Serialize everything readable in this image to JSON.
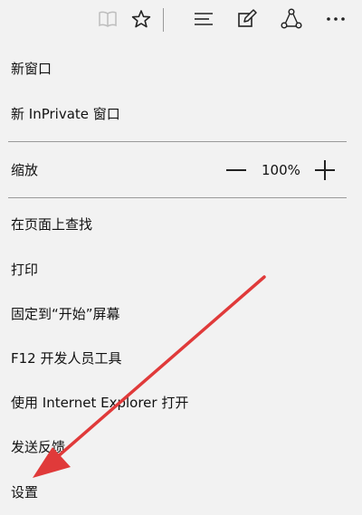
{
  "toolbar": {
    "icons": [
      "reading-view-icon",
      "favorite-star-icon",
      "hub-icon",
      "web-note-icon",
      "share-icon",
      "more-icon"
    ]
  },
  "menu": {
    "new_window": "新窗口",
    "new_inprivate": "新 InPrivate 窗口",
    "zoom_label": "缩放",
    "zoom_value": "100%",
    "find_on_page": "在页面上查找",
    "print": "打印",
    "pin_to_start": "固定到“开始”屏幕",
    "f12_devtools": "F12 开发人员工具",
    "open_with_ie": "使用 Internet Explorer 打开",
    "send_feedback": "发送反馈",
    "settings": "设置"
  },
  "colors": {
    "background": "#f2f2f2",
    "divider": "#9a9a9a",
    "arrow": "#e03a3a",
    "icon": "#222222",
    "disabled_icon": "#bdbdbd"
  }
}
